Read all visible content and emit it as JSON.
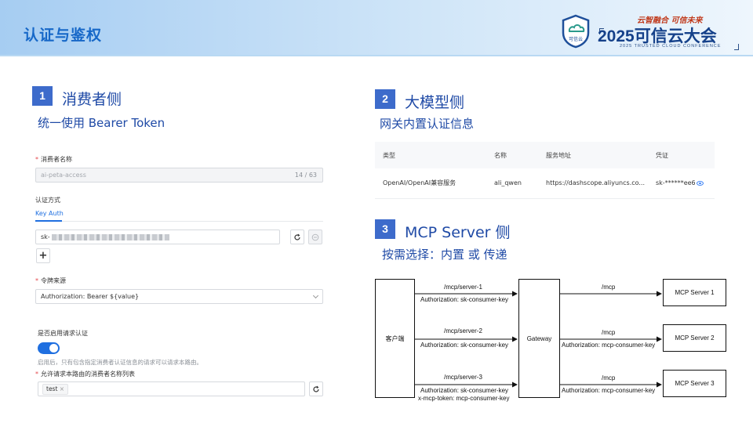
{
  "header": {
    "title": "认证与鉴权",
    "logo_emblem_text": "可信云",
    "slogan": "云智融合 可信未来",
    "conference_title": "2025可信云大会",
    "conference_subtitle": "2025 TRUSTED CLOUD CONFERENCE"
  },
  "colors": {
    "accent": "#1f4aa6",
    "badge": "#3d6bcb",
    "primary_blue": "#1f6fe0"
  },
  "section1": {
    "number": "1",
    "title": "消费者侧",
    "subtitle": "统一使用 Bearer Token",
    "form": {
      "consumer_name_label": "消费者名称",
      "consumer_name_value": "ai-peta-access",
      "consumer_name_counter": "14 / 63",
      "auth_method_label": "认证方式",
      "auth_tab": "Key Auth",
      "key_prefix": "sk-",
      "add_icon": "plus-icon",
      "token_source_label": "令牌来源",
      "token_source_value": "Authorization: Bearer ${value}",
      "enable_auth_label": "是否启用请求认证",
      "enable_auth_on": true,
      "enable_auth_hint": "启用后，只有包含指定消费者认证信息的请求可以请求本路由。",
      "allowed_consumers_label": "允许请求本路由的消费者名称列表",
      "allowed_consumers_tags": [
        "test"
      ]
    }
  },
  "section2": {
    "number": "2",
    "title": "大模型侧",
    "subtitle": "网关内置认证信息",
    "table": {
      "headers": [
        "类型",
        "名称",
        "服务地址",
        "凭证"
      ],
      "rows": [
        [
          "OpenAI/OpenAI兼容服务",
          "ali_qwen",
          "https://dashscope.aliyuncs.co...",
          "sk-******ee6"
        ]
      ]
    }
  },
  "section3": {
    "number": "3",
    "title": "MCP Server 侧",
    "subtitle": "按需选择：内置  或  传递",
    "diagram": {
      "client": "客户端",
      "gateway": "Gateway",
      "servers": [
        "MCP Server 1",
        "MCP Server 2",
        "MCP Server 3"
      ],
      "left_paths": [
        "/mcp/server-1",
        "/mcp/server-2",
        "/mcp/server-3"
      ],
      "left_auth": [
        "Authorization: sk-consumer-key",
        "Authorization: sk-consumer-key",
        "Authorization: sk-consumer-key"
      ],
      "left_extra": "x-mcp-token: mcp-consumer-key",
      "right_paths": [
        "/mcp",
        "/mcp",
        "/mcp"
      ],
      "right_auth": [
        "Authorization: mcp-consumer-key",
        "Authorization: mcp-consumer-key"
      ]
    }
  }
}
